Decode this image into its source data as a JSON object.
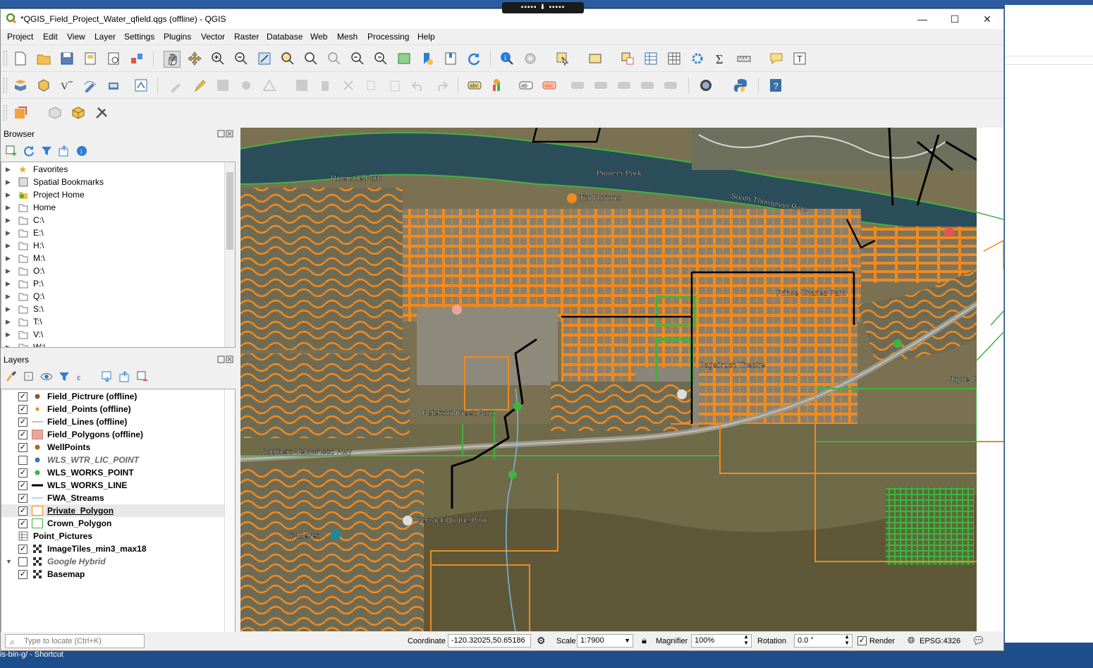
{
  "window": {
    "title": "*QGIS_Field_Project_Water_qfield.qgs (offline) - QGIS",
    "controls": {
      "minimize": "—",
      "maximize": "☐",
      "close": "✕"
    }
  },
  "menu": [
    "Project",
    "Edit",
    "View",
    "Layer",
    "Settings",
    "Plugins",
    "Vector",
    "Raster",
    "Database",
    "Web",
    "Mesh",
    "Processing",
    "Help"
  ],
  "browser": {
    "title": "Browser",
    "items": [
      {
        "label": "Favorites",
        "icon": "star-icon"
      },
      {
        "label": "Spatial Bookmarks",
        "icon": "bookmark-icon"
      },
      {
        "label": "Project Home",
        "icon": "project-folder-icon"
      },
      {
        "label": "Home",
        "icon": "folder-icon"
      },
      {
        "label": "C:\\",
        "icon": "folder-icon"
      },
      {
        "label": "E:\\",
        "icon": "folder-icon"
      },
      {
        "label": "H:\\",
        "icon": "folder-icon"
      },
      {
        "label": "M:\\",
        "icon": "folder-icon"
      },
      {
        "label": "O:\\",
        "icon": "folder-icon"
      },
      {
        "label": "P:\\",
        "icon": "folder-icon"
      },
      {
        "label": "Q:\\",
        "icon": "folder-icon"
      },
      {
        "label": "S:\\",
        "icon": "folder-icon"
      },
      {
        "label": "T:\\",
        "icon": "folder-icon"
      },
      {
        "label": "V:\\",
        "icon": "folder-icon"
      },
      {
        "label": "W:\\",
        "icon": "folder-icon"
      }
    ]
  },
  "layers": {
    "title": "Layers",
    "items": [
      {
        "label": "Field_Pictrure (offline)",
        "checked": true,
        "symbol": "point-brown",
        "italic": false
      },
      {
        "label": "Field_Points (offline)",
        "checked": true,
        "symbol": "point-orange-small",
        "italic": false
      },
      {
        "label": "Field_Lines (offline)",
        "checked": true,
        "symbol": "line-gray",
        "italic": false
      },
      {
        "label": "Field_Polygons (offline)",
        "checked": true,
        "symbol": "polygon-pink",
        "italic": false
      },
      {
        "label": "WellPoints",
        "checked": true,
        "symbol": "point-brown",
        "italic": false
      },
      {
        "label": "WLS_WTR_LIC_POINT",
        "checked": false,
        "symbol": "point-blue",
        "italic": true
      },
      {
        "label": "WLS_WORKS_POINT",
        "checked": true,
        "symbol": "point-green",
        "italic": false
      },
      {
        "label": "WLS_WORKS_LINE",
        "checked": true,
        "symbol": "line-black",
        "italic": false
      },
      {
        "label": "FWA_Streams",
        "checked": true,
        "symbol": "line-lightblue",
        "italic": false
      },
      {
        "label": "Private_Polygon",
        "checked": true,
        "symbol": "polygon-orange",
        "italic": false,
        "selected": true
      },
      {
        "label": "Crown_Polygon",
        "checked": true,
        "symbol": "polygon-green",
        "italic": false
      },
      {
        "label": "Point_Pictures",
        "checked": null,
        "symbol": "table",
        "italic": false
      },
      {
        "label": "ImageTiles_min3_max18",
        "checked": true,
        "symbol": "raster",
        "italic": false
      },
      {
        "label": "Google Hybrid",
        "checked": false,
        "symbol": "raster",
        "italic": true
      },
      {
        "label": "Basemap",
        "checked": true,
        "symbol": "raster",
        "italic": false
      }
    ]
  },
  "map_labels": [
    {
      "text": "Riverside Park"
    },
    {
      "text": "Pioneer Park"
    },
    {
      "text": "Tim Hortons"
    },
    {
      "text": "Sagebrush Theatre"
    },
    {
      "text": "Peterson Creek Park"
    },
    {
      "text": "Southern Yellowhead Hwy"
    },
    {
      "text": "Berwick On the Park"
    },
    {
      "text": "7-Eleven"
    },
    {
      "text": "South Thompson River"
    },
    {
      "text": "Prince Charles Park"
    },
    {
      "text": "Joyce Cu"
    }
  ],
  "status": {
    "locate_placeholder": "Type to locate (Ctrl+K)",
    "coordinate_label": "Coordinate",
    "coordinate_value": "-120.32025,50.65186",
    "scale_label": "Scale",
    "scale_value": "1:7900",
    "magnifier_label": "Magnifier",
    "magnifier_value": "100%",
    "rotation_label": "Rotation",
    "rotation_value": "0.0 °",
    "render_label": "Render",
    "crs": "EPSG:4326"
  },
  "desktop": {
    "shortcut_text": "is-bin-g/ - Shortcut"
  },
  "colors": {
    "private_polygon": "#f08a1e",
    "crown_polygon": "#3fb43f",
    "works_line": "#000000",
    "river": "#2c4d5a"
  }
}
